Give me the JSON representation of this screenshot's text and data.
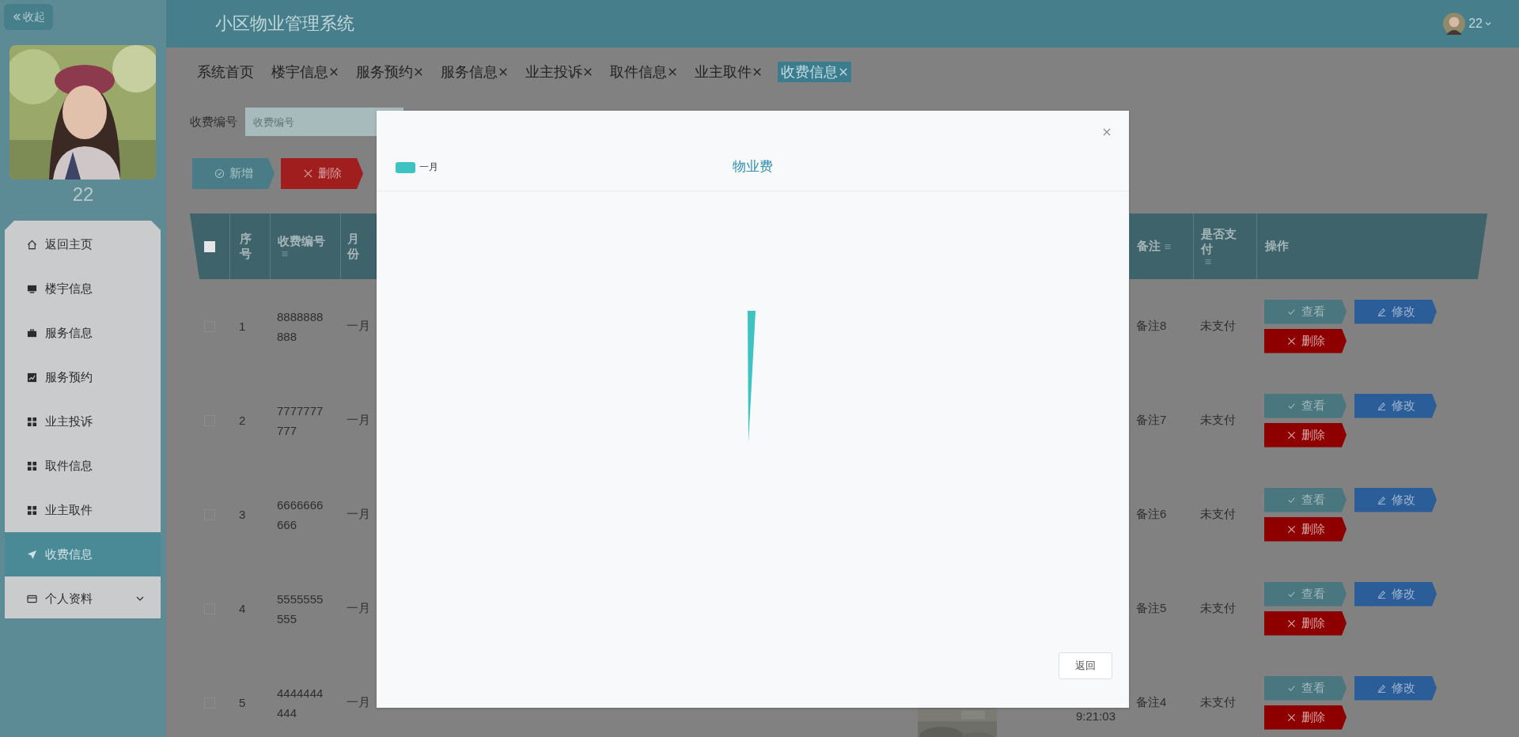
{
  "sidebar": {
    "collapse_label": "收起",
    "user_name": "22",
    "menu": [
      {
        "label": "返回主页",
        "selected": false
      },
      {
        "label": "楼宇信息",
        "selected": false
      },
      {
        "label": "服务信息",
        "selected": false
      },
      {
        "label": "服务预约",
        "selected": false
      },
      {
        "label": "业主投诉",
        "selected": false
      },
      {
        "label": "取件信息",
        "selected": false
      },
      {
        "label": "业主取件",
        "selected": false
      },
      {
        "label": "收费信息",
        "selected": true
      },
      {
        "label": "个人资料",
        "selected": false,
        "expanded": false
      }
    ]
  },
  "header": {
    "title": "小区物业管理系统",
    "user": "22"
  },
  "tabs": [
    {
      "label": "系统首页",
      "closable": false,
      "selected": false
    },
    {
      "label": "楼宇信息",
      "closable": true,
      "selected": false
    },
    {
      "label": "服务预约",
      "closable": true,
      "selected": false
    },
    {
      "label": "服务信息",
      "closable": true,
      "selected": false
    },
    {
      "label": "业主投诉",
      "closable": true,
      "selected": false
    },
    {
      "label": "取件信息",
      "closable": true,
      "selected": false
    },
    {
      "label": "业主取件",
      "closable": true,
      "selected": false
    },
    {
      "label": "收费信息",
      "closable": true,
      "selected": true
    }
  ],
  "search": {
    "label": "收费编号",
    "placeholder": "收费编号"
  },
  "toolbar": [
    {
      "label": "新增",
      "kind": "add"
    },
    {
      "label": "删除",
      "kind": "delete"
    }
  ],
  "table": {
    "select_all": false,
    "columns": [
      {
        "label": "序号",
        "sortable": false
      },
      {
        "label": "收费编号",
        "sortable": true
      },
      {
        "label": "月份",
        "sortable": false
      },
      {
        "label": "备注",
        "sortable": true
      },
      {
        "label": "是否支付",
        "sortable": true
      },
      {
        "label": "操作",
        "sortable": false
      }
    ],
    "rows": [
      {
        "selected": false,
        "seq": "1",
        "code": "8888888888",
        "month": "一月",
        "note": "备注8",
        "paid": "未支付",
        "actions": [
          {
            "label": "查看",
            "kind": "view"
          },
          {
            "label": "修改",
            "kind": "edit"
          },
          {
            "label": "删除",
            "kind": "delete"
          }
        ]
      },
      {
        "selected": false,
        "seq": "2",
        "code": "7777777777",
        "month": "一月",
        "note": "备注7",
        "paid": "未支付",
        "actions": [
          {
            "label": "查看",
            "kind": "view"
          },
          {
            "label": "修改",
            "kind": "edit"
          },
          {
            "label": "删除",
            "kind": "delete"
          }
        ]
      },
      {
        "selected": false,
        "seq": "3",
        "code": "6666666666",
        "month": "一月",
        "note": "备注6",
        "paid": "未支付",
        "actions": [
          {
            "label": "查看",
            "kind": "view"
          },
          {
            "label": "修改",
            "kind": "edit"
          },
          {
            "label": "删除",
            "kind": "delete"
          }
        ]
      },
      {
        "selected": false,
        "seq": "4",
        "code": "5555555555",
        "month": "一月",
        "note": "备注5",
        "paid": "未支付",
        "actions": [
          {
            "label": "查看",
            "kind": "view"
          },
          {
            "label": "修改",
            "kind": "edit"
          },
          {
            "label": "删除",
            "kind": "delete"
          }
        ]
      },
      {
        "selected": false,
        "seq": "5",
        "code": "4444444444",
        "month": "一月",
        "note": "备注4",
        "paid": "未支付",
        "time": "9:21:03",
        "actions": [
          {
            "label": "查看",
            "kind": "view"
          },
          {
            "label": "修改",
            "kind": "edit"
          },
          {
            "label": "删除",
            "kind": "delete"
          }
        ]
      }
    ]
  },
  "modal": {
    "title": "物业费",
    "legend": [
      {
        "label": "一月",
        "color": "#3ec3c3"
      }
    ],
    "button": "返回"
  }
}
